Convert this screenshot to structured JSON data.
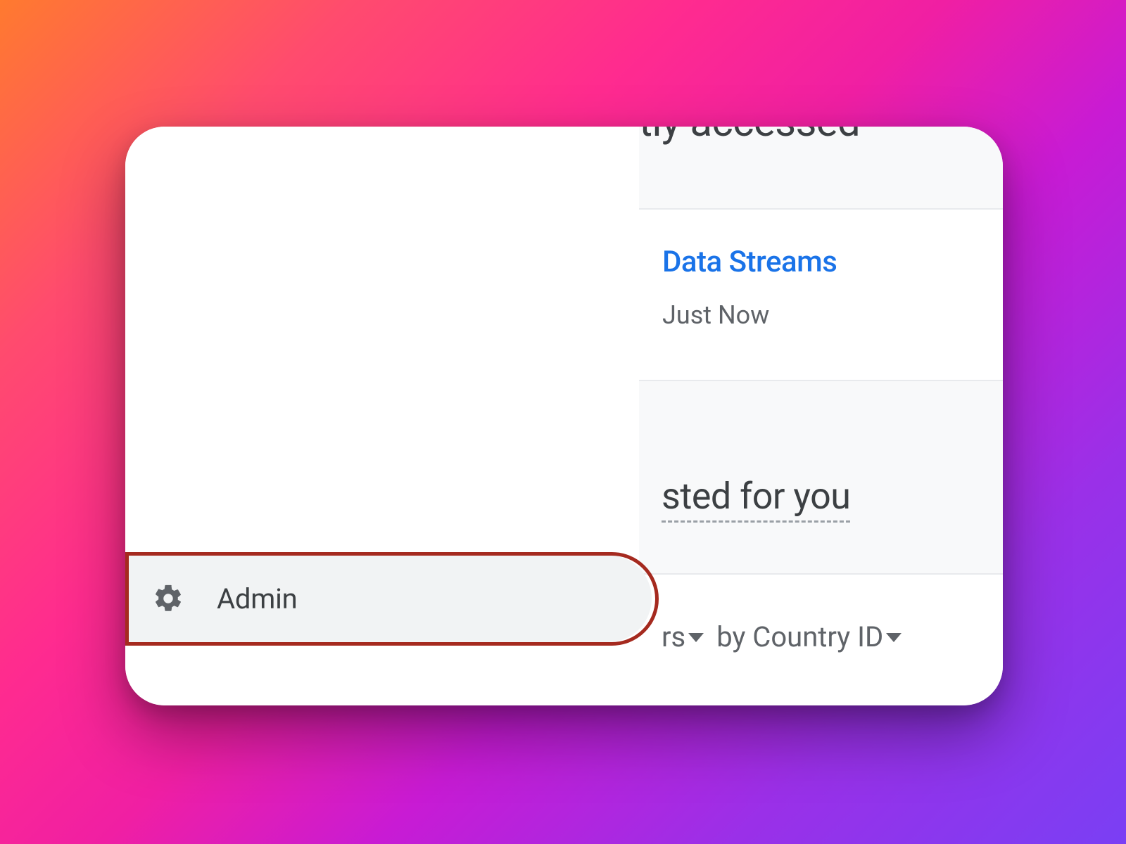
{
  "sidebar": {
    "admin_label": "Admin"
  },
  "header": {
    "title": "tly accessed"
  },
  "recent": {
    "item_title": "Data Streams",
    "item_time": "Just Now"
  },
  "suggested": {
    "title": "sted for you"
  },
  "filters": {
    "frag1": "rs",
    "by_label": "by Country ID"
  }
}
